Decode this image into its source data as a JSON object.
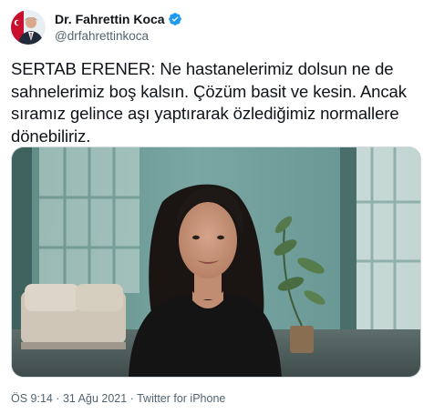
{
  "author": {
    "display_name": "Dr. Fahrettin Koca",
    "handle": "@drfahrettinkoca",
    "verified_color": "#1d9bf0"
  },
  "tweet": {
    "text": "SERTAB ERENER: Ne hastanelerimiz dolsun ne de sahnelerimiz boş kalsın. Çözüm basit ve kesin. Ancak sıramız gelince aşı yaptırarak özlediğimiz normallere dönebiliriz."
  },
  "meta": {
    "time": "ÖS 9:14",
    "separator1": " · ",
    "date": "31 Ağu 2021",
    "separator2": " · ",
    "source": "Twitter for iPhone"
  },
  "colors": {
    "text": "#0f1419",
    "secondary": "#536471",
    "border": "#cfd9de"
  }
}
